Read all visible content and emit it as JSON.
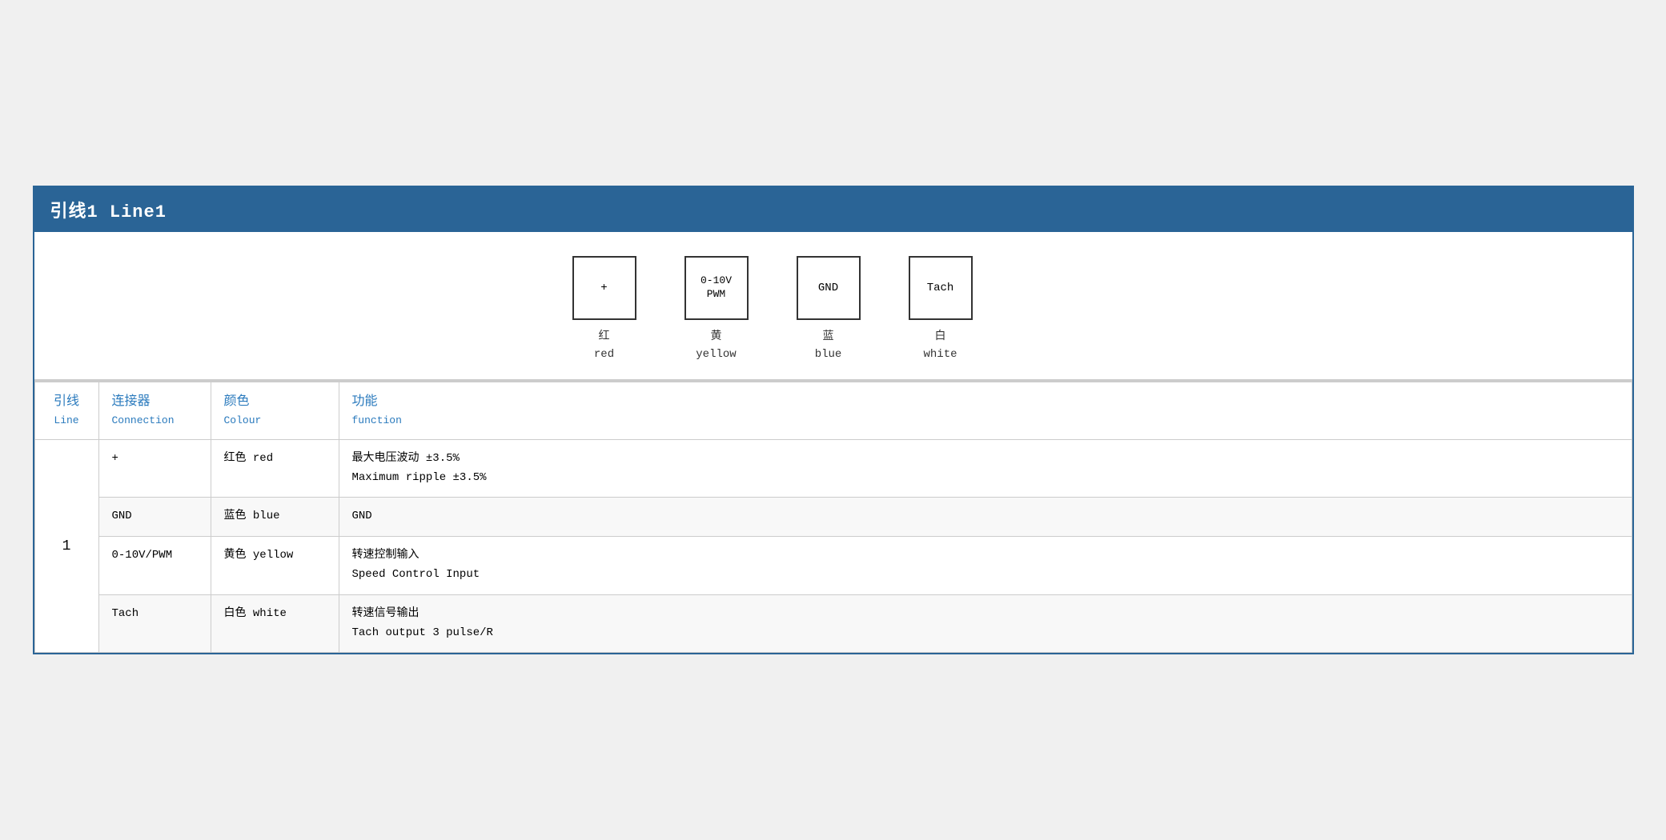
{
  "header": {
    "title": "引线1  Line1"
  },
  "diagram": {
    "pins": [
      {
        "label": "+",
        "chinese": "红",
        "english": "red"
      },
      {
        "label": "0-10V\nPWM",
        "chinese": "黄",
        "english": "yellow"
      },
      {
        "label": "GND",
        "chinese": "蓝",
        "english": "blue"
      },
      {
        "label": "Tach",
        "chinese": "白",
        "english": "white"
      }
    ]
  },
  "table": {
    "columns": {
      "line_cn": "引线",
      "line_en": "Line",
      "connection_cn": "连接器",
      "connection_en": "Connection",
      "colour_cn": "颜色",
      "colour_en": "Colour",
      "function_cn": "功能",
      "function_en": "function"
    },
    "rows": [
      {
        "line": "1",
        "connection": "+",
        "colour_cn": "红色 red",
        "function_cn": "最大电压波动 ±3.5%",
        "function_en": "Maximum ripple ±3.5%"
      },
      {
        "line": "",
        "connection": "GND",
        "colour_cn": "蓝色 blue",
        "function_cn": "GND",
        "function_en": ""
      },
      {
        "line": "",
        "connection": "0-10V/PWM",
        "colour_cn": "黄色 yellow",
        "function_cn": "转速控制输入",
        "function_en": "Speed Control Input"
      },
      {
        "line": "",
        "connection": "Tach",
        "colour_cn": "白色 white",
        "function_cn": "转速信号输出",
        "function_en": "Tach output 3 pulse/R"
      }
    ]
  }
}
